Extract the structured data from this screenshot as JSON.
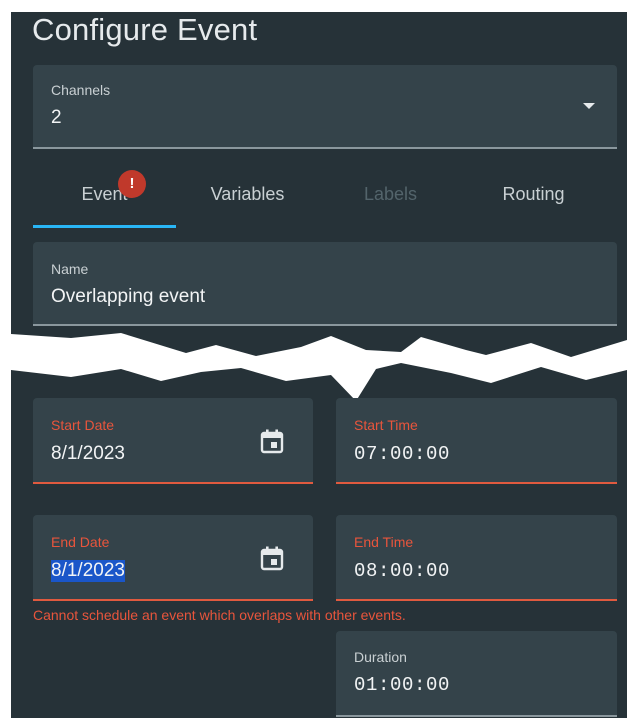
{
  "title": "Configure Event",
  "channels": {
    "label": "Channels",
    "value": "2"
  },
  "tabs": [
    {
      "label": "Event",
      "badge": "!"
    },
    {
      "label": "Variables"
    },
    {
      "label": "Labels"
    },
    {
      "label": "Routing"
    }
  ],
  "name_field": {
    "label": "Name",
    "value": "Overlapping event"
  },
  "start_date": {
    "label": "Start Date",
    "value": "8/1/2023"
  },
  "start_time": {
    "label": "Start Time",
    "value": "07:00:00"
  },
  "end_date": {
    "label": "End Date",
    "value": "8/1/2023"
  },
  "end_time": {
    "label": "End Time",
    "value": "08:00:00"
  },
  "error_message": "Cannot schedule an event which overlaps with other events.",
  "duration": {
    "label": "Duration",
    "value": "01:00:00"
  },
  "colors": {
    "background": "#263238",
    "field": "#34434a",
    "accent": "#29b6f6",
    "error": "#e8553c",
    "badge": "#c0392b",
    "selection": "#1a56c9"
  }
}
